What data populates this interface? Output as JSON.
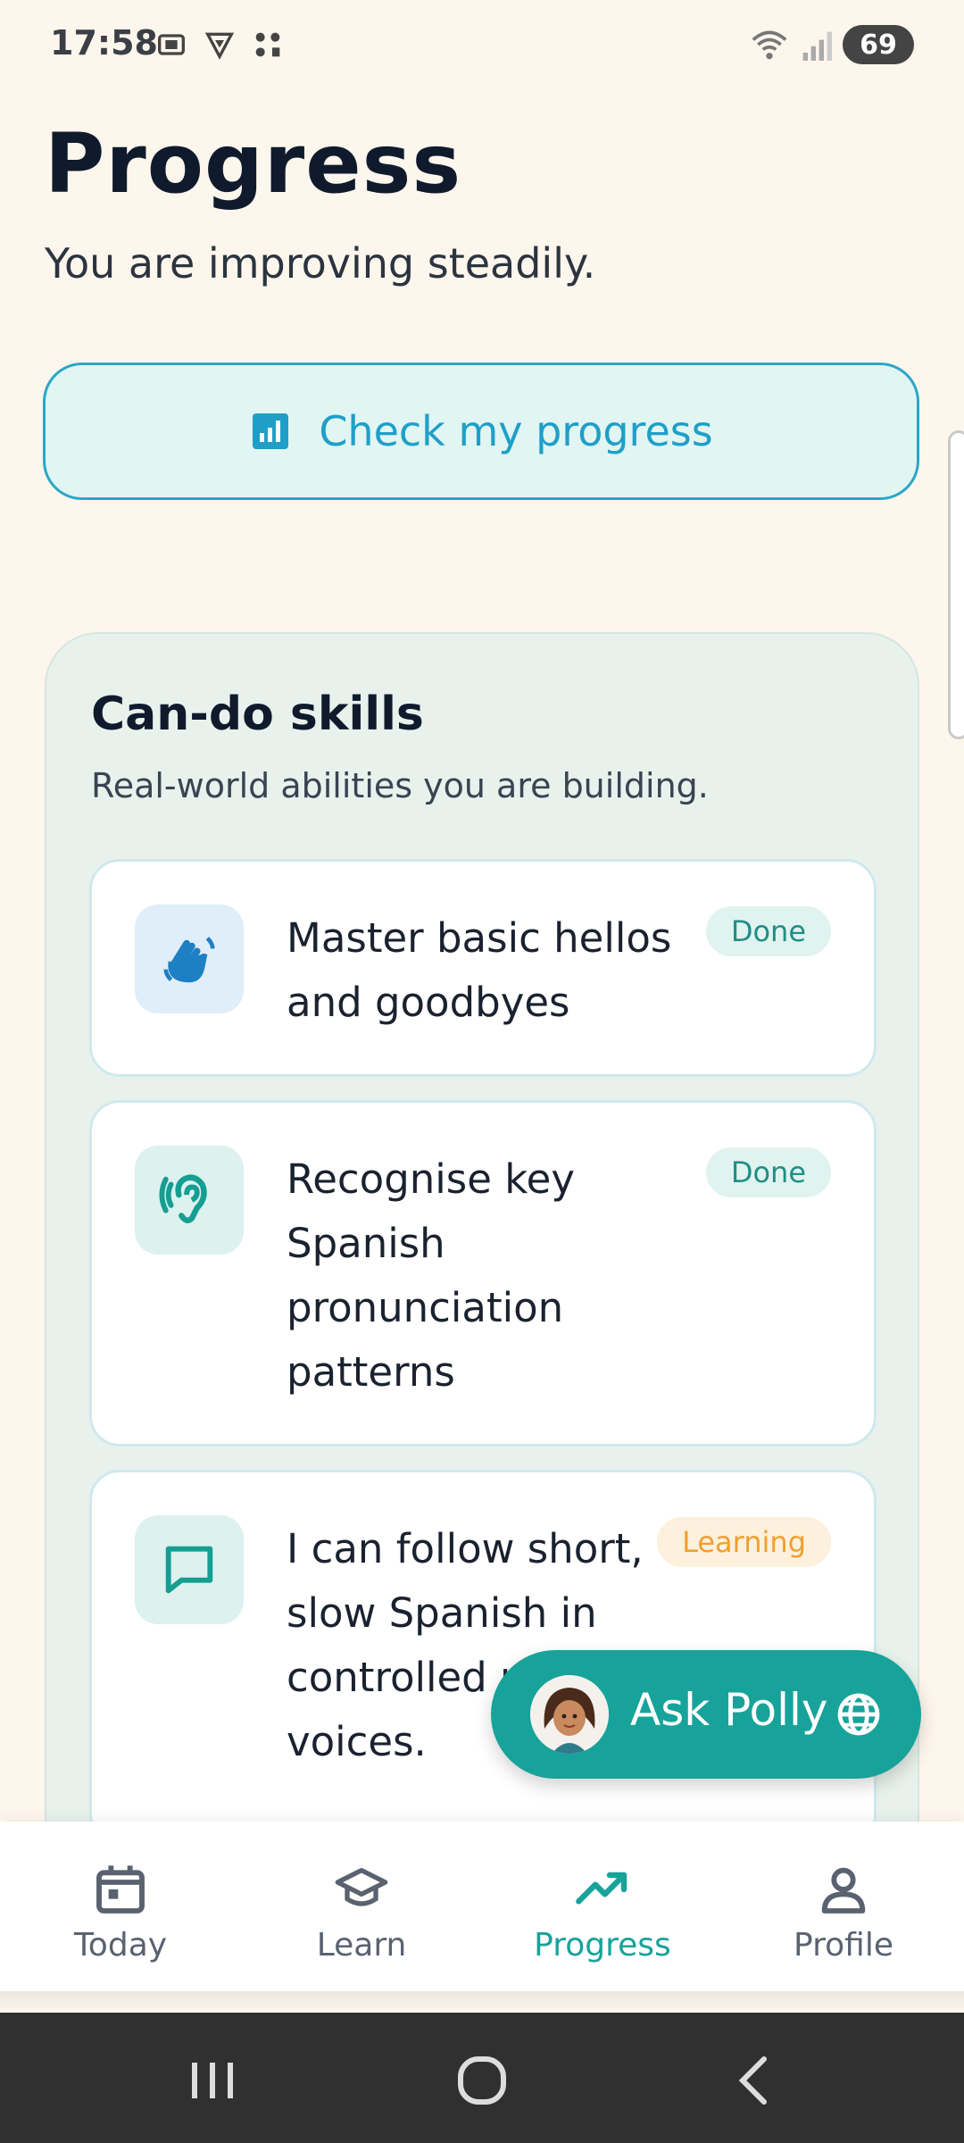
{
  "status_bar": {
    "time": "17:58",
    "battery": "69"
  },
  "header": {
    "title": "Progress",
    "subtitle": "You are improving steadily."
  },
  "check_button": {
    "label": "Check my progress",
    "icon": "chart-icon"
  },
  "skills": {
    "title": "Can-do skills",
    "subtitle": "Real-world abilities you are building.",
    "items": [
      {
        "text": "Master basic hellos and goodbyes",
        "status": "Done",
        "icon": "waving-hand-icon"
      },
      {
        "text": "Recognise key Spanish pronunciation patterns",
        "status": "Done",
        "icon": "ear-icon"
      },
      {
        "text": "I can follow short, slow Spanish in controlled regional voices.",
        "status": "Learning",
        "icon": "chat-bubble-icon"
      }
    ]
  },
  "fab": {
    "label": "Ask Polly",
    "icon": "globe-icon"
  },
  "bottom_nav": {
    "items": [
      {
        "label": "Today",
        "icon": "calendar-icon"
      },
      {
        "label": "Learn",
        "icon": "graduation-cap-icon"
      },
      {
        "label": "Progress",
        "icon": "trending-up-icon",
        "active": true
      },
      {
        "label": "Profile",
        "icon": "person-icon"
      }
    ]
  },
  "colors": {
    "accent": "#17a39a",
    "link_blue": "#1f9fc7",
    "background": "#fdf6ec",
    "learning": "#f0a030"
  }
}
